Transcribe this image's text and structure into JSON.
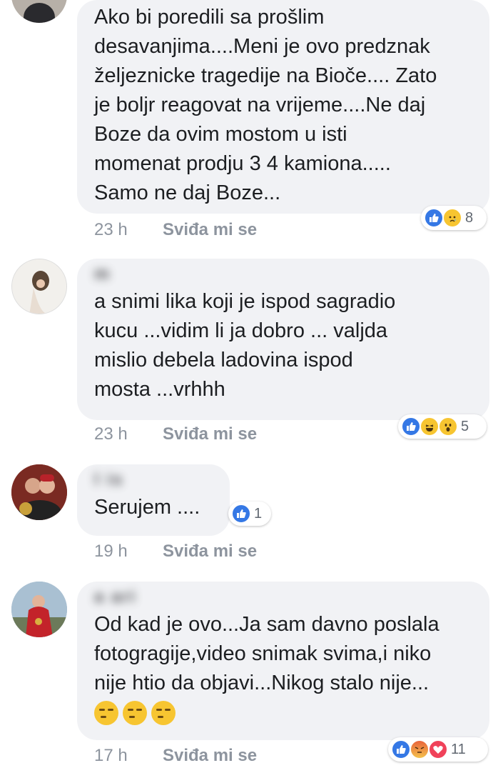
{
  "comments": [
    {
      "text": "Ako bi poredili sa prošlim\ndesavanjima....Meni je ovo predznak\nželjeznicke tragedije na Bioče.... Zato\nje boljr reagovat na vrijeme....Ne daj\nBoze da ovim mostom u isti\nmomenat prodju 3 4 kamiona.....\nSamo ne daj Boze...",
      "time": "23 h",
      "like_label": "Sviđa mi se",
      "reactions": [
        "like-icon",
        "sad-icon"
      ],
      "reaction_count": "8"
    },
    {
      "name": "m",
      "text": "a snimi lika koji je ispod sagradio\nkucu ...vidim li ja dobro ... valjda\nmislio debela ladovina ispod\nmosta ...vrhhh",
      "time": "23 h",
      "like_label": "Sviđa mi se",
      "reactions": [
        "like-icon",
        "haha-icon",
        "wow-icon"
      ],
      "reaction_count": "5"
    },
    {
      "name": "l  is",
      "text": "Serujem ....",
      "time": "19 h",
      "like_label": "Sviđa mi se",
      "reactions": [
        "like-icon"
      ],
      "reaction_count": "1"
    },
    {
      "name": "a  ari",
      "text": "Od kad je ovo...Ja sam davno poslala\nfotogragije,video snimak svima,i niko\nnije htio da objavi...Nikog stalo nije...",
      "emojis": [
        "unamused-emoji",
        "unamused-emoji",
        "unamused-emoji"
      ],
      "time": "17 h",
      "like_label": "Sviđa mi se",
      "reactions": [
        "like-icon",
        "angry-icon",
        "love-icon"
      ],
      "reaction_count": "11"
    }
  ],
  "colors": {
    "bubble": "#f1f2f5",
    "meta": "#8d949e",
    "like_blue": "#3578e5"
  }
}
